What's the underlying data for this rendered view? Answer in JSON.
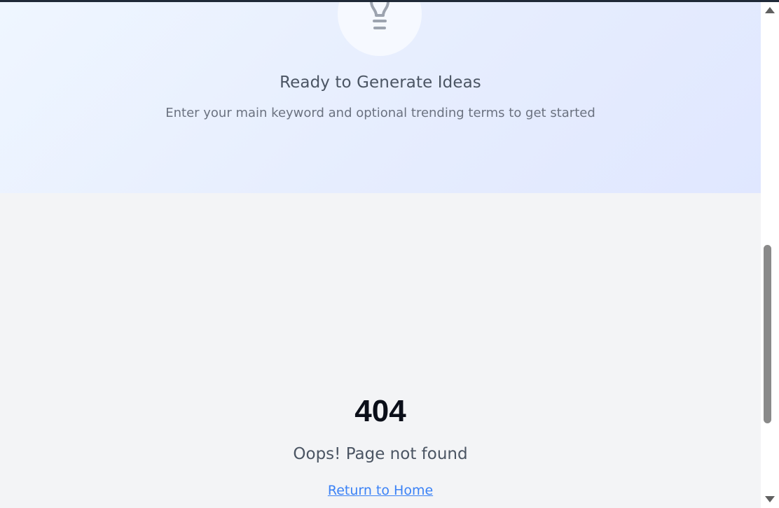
{
  "hero": {
    "icon": "lightbulb-icon",
    "title": "Ready to Generate Ideas",
    "subtitle": "Enter your main keyword and optional trending terms to get started"
  },
  "not_found": {
    "code": "404",
    "message": "Oops! Page not found",
    "link_label": "Return to Home"
  },
  "colors": {
    "hero_gradient_start": "#eff6ff",
    "hero_gradient_end": "#e0e7ff",
    "page_background": "#f3f4f6",
    "link": "#3b82f6",
    "heading": "#0b0f19"
  },
  "scrollbar": {
    "up_icon": "triangle-up-icon",
    "down_icon": "triangle-down-icon"
  }
}
